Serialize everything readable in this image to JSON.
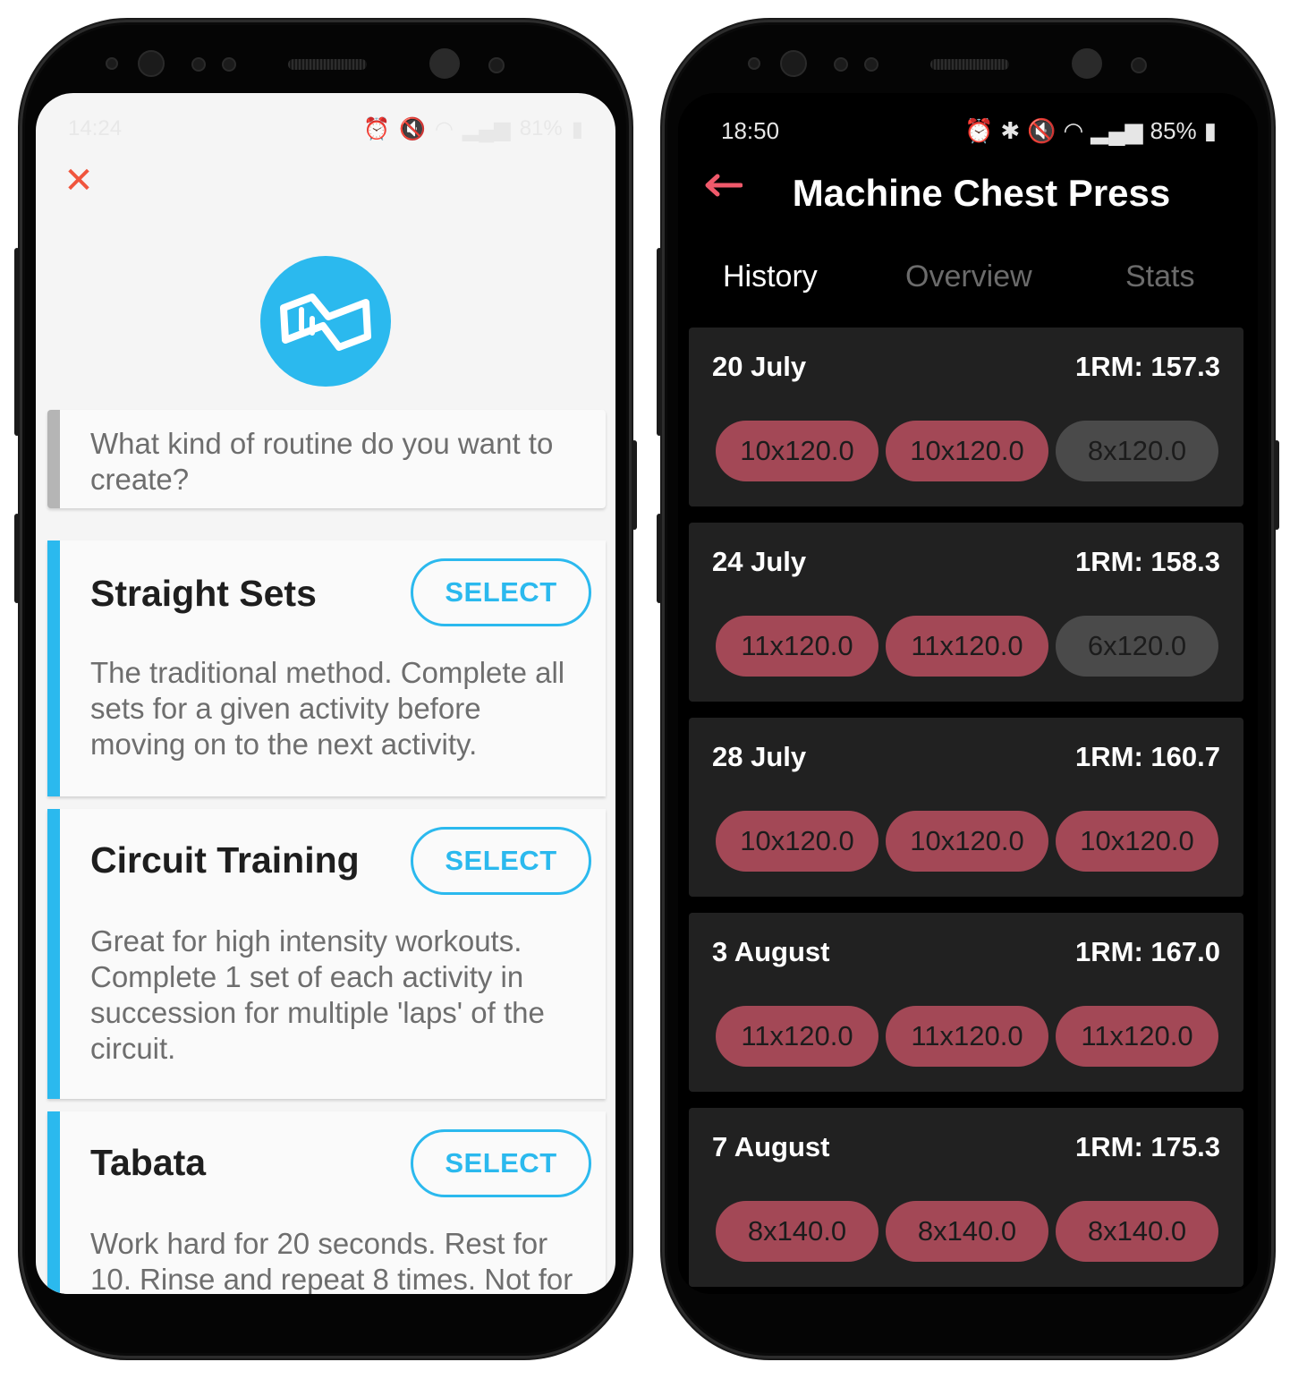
{
  "left_phone": {
    "status_bar": {
      "time": "14:24",
      "battery": "81%"
    },
    "question": "What kind of routine do you want to create?",
    "routines": [
      {
        "title": "Straight Sets",
        "select_label": "SELECT",
        "description": "The traditional method. Complete all sets for a given activity before moving on to the next activity."
      },
      {
        "title": "Circuit Training",
        "select_label": "SELECT",
        "description": "Great for high intensity workouts. Complete 1 set of each activity in succession for multiple 'laps' of the circuit."
      },
      {
        "title": "Tabata",
        "select_label": "SELECT",
        "description": "Work hard for 20 seconds. Rest for 10. Rinse and repeat 8 times. Not for"
      }
    ],
    "icons": {
      "close": "close-icon",
      "logo": "app-logo-icon"
    },
    "colors": {
      "accent": "#2bb9ee",
      "close": "#f0553d"
    }
  },
  "right_phone": {
    "status_bar": {
      "time": "18:50",
      "battery": "85%"
    },
    "title": "Machine Chest Press",
    "tabs": [
      {
        "label": "History",
        "active": true
      },
      {
        "label": "Overview",
        "active": false
      },
      {
        "label": "Stats",
        "active": false
      }
    ],
    "history": [
      {
        "date": "20 July",
        "one_rm": "1RM: 157.3",
        "sets": [
          {
            "label": "10x120.0",
            "done": true
          },
          {
            "label": "10x120.0",
            "done": true
          },
          {
            "label": "8x120.0",
            "done": false
          }
        ]
      },
      {
        "date": "24 July",
        "one_rm": "1RM: 158.3",
        "sets": [
          {
            "label": "11x120.0",
            "done": true
          },
          {
            "label": "11x120.0",
            "done": true
          },
          {
            "label": "6x120.0",
            "done": false
          }
        ]
      },
      {
        "date": "28 July",
        "one_rm": "1RM: 160.7",
        "sets": [
          {
            "label": "10x120.0",
            "done": true
          },
          {
            "label": "10x120.0",
            "done": true
          },
          {
            "label": "10x120.0",
            "done": true
          }
        ]
      },
      {
        "date": "3 August",
        "one_rm": "1RM: 167.0",
        "sets": [
          {
            "label": "11x120.0",
            "done": true
          },
          {
            "label": "11x120.0",
            "done": true
          },
          {
            "label": "11x120.0",
            "done": true
          }
        ]
      },
      {
        "date": "7 August",
        "one_rm": "1RM: 175.3",
        "sets": [
          {
            "label": "8x140.0",
            "done": true
          },
          {
            "label": "8x140.0",
            "done": true
          },
          {
            "label": "8x140.0",
            "done": true
          }
        ]
      }
    ],
    "icons": {
      "back": "back-arrow-icon"
    },
    "colors": {
      "set_done": "#a34856",
      "set_missed": "#4a4a4a",
      "back_arrow": "#f0596b"
    }
  }
}
